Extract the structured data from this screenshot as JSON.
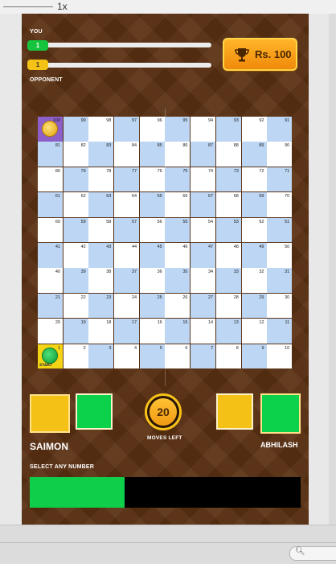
{
  "toolbar": {
    "zoom": "1x"
  },
  "hud": {
    "you_label": "YOU",
    "opponent_label": "OPPONENT",
    "you_progress": "1",
    "opponent_progress": "1",
    "prize": "Rs. 100",
    "prize_icon": "trophy-icon"
  },
  "board": {
    "start_label": "START",
    "cells": [
      [
        100,
        99,
        98,
        97,
        96,
        95,
        94,
        93,
        92,
        91
      ],
      [
        81,
        82,
        83,
        84,
        85,
        86,
        87,
        88,
        89,
        90
      ],
      [
        80,
        79,
        78,
        77,
        76,
        75,
        74,
        73,
        72,
        71
      ],
      [
        61,
        62,
        63,
        64,
        65,
        66,
        67,
        68,
        69,
        70
      ],
      [
        60,
        59,
        58,
        57,
        56,
        55,
        54,
        53,
        52,
        51
      ],
      [
        41,
        42,
        43,
        44,
        45,
        46,
        47,
        48,
        49,
        50
      ],
      [
        40,
        39,
        38,
        37,
        36,
        35,
        34,
        33,
        32,
        31
      ],
      [
        21,
        22,
        23,
        24,
        25,
        26,
        27,
        28,
        29,
        30
      ],
      [
        20,
        19,
        18,
        17,
        16,
        15,
        14,
        13,
        12,
        11
      ],
      [
        1,
        2,
        3,
        4,
        5,
        6,
        7,
        8,
        9,
        10
      ]
    ]
  },
  "moves": {
    "value": "20",
    "label": "MOVES LEFT"
  },
  "players": {
    "left_name": "SAIMON",
    "right_name": "ABHILASH"
  },
  "select": {
    "label": "SELECT ANY NUMBER",
    "fill_fraction": 0.35
  },
  "colors": {
    "player_green": "#0bd14b",
    "player_yellow": "#f4c217",
    "cell_blue": "#bcd6f4"
  }
}
